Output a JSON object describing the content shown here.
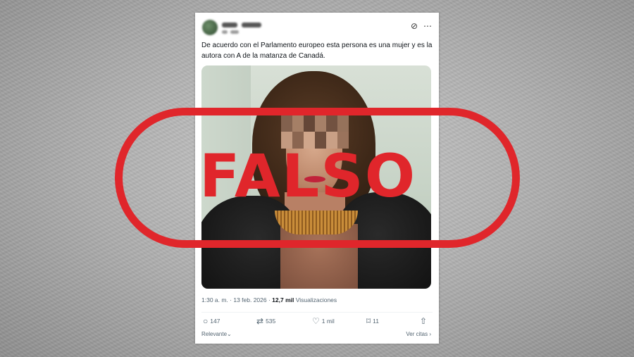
{
  "tweet": {
    "text_line1": "De acuerdo con el Parlamento europeo esta persona es una mujer y es la",
    "text_line2": "autora con A  de la matanza de Canadá.",
    "time": "1:30 a. m. · 13 feb. 2026 · ",
    "views_count": "12,7 mil",
    "views_label": " Visualizaciones",
    "header_icons": {
      "grok": "grok-icon",
      "more": "more-icon"
    }
  },
  "actions": {
    "replies": "147",
    "reposts": "535",
    "likes": "1 mil",
    "bookmarks": "11"
  },
  "footer": {
    "sort": "Relevante",
    "quotes": "Ver citas"
  },
  "stamp": {
    "label": "FALSO",
    "color": "#e0262b"
  }
}
